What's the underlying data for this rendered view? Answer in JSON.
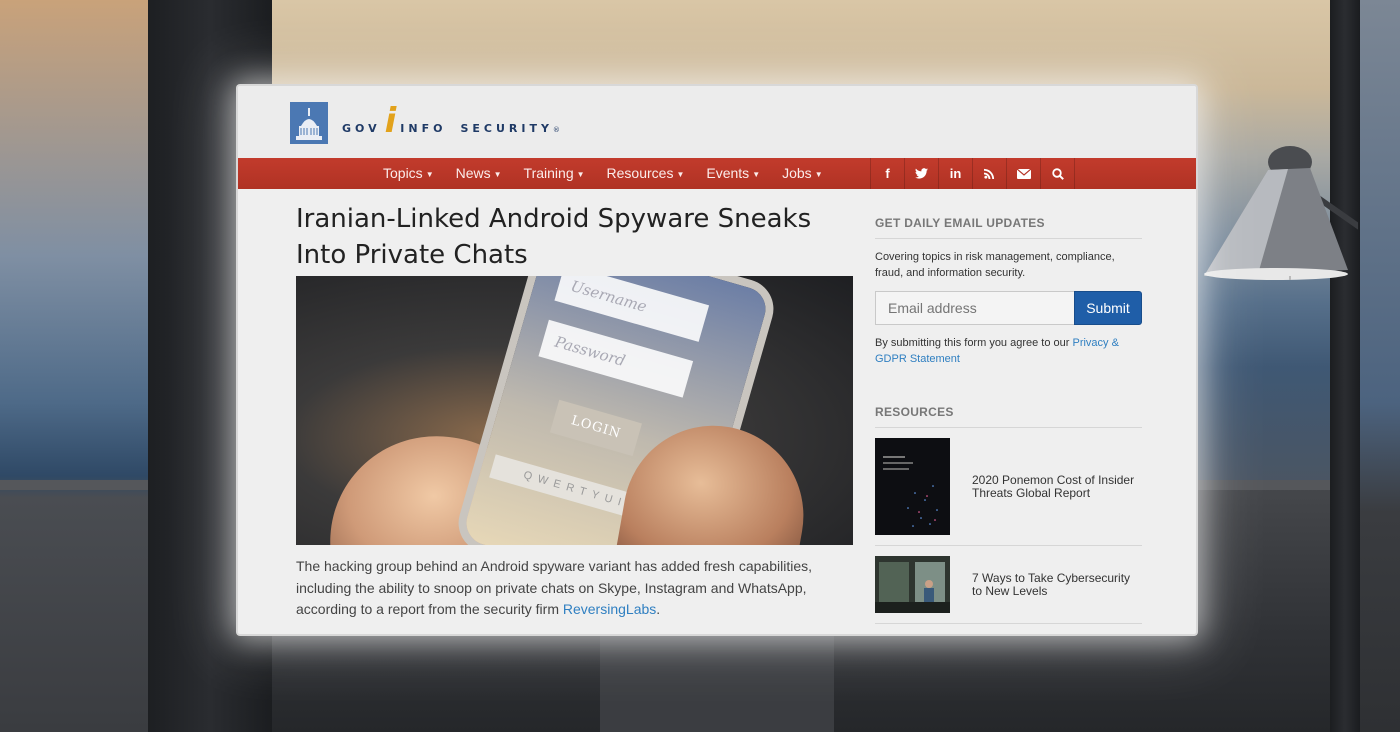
{
  "site": {
    "logo_gov": "GOV",
    "logo_i": "i",
    "logo_info": "INFO",
    "logo_security": "SECURITY",
    "logo_reg": "®"
  },
  "nav": {
    "items": [
      {
        "label": "Topics"
      },
      {
        "label": "News"
      },
      {
        "label": "Training"
      },
      {
        "label": "Resources"
      },
      {
        "label": "Events"
      },
      {
        "label": "Jobs"
      }
    ],
    "icons": [
      {
        "glyph": "f",
        "name": "facebook-icon"
      },
      {
        "glyph": "🐦",
        "name": "twitter-icon"
      },
      {
        "glyph": "in",
        "name": "linkedin-icon"
      },
      {
        "glyph": "◗",
        "name": "rss-icon"
      },
      {
        "glyph": "✉",
        "name": "envelope-icon"
      },
      {
        "glyph": "⌕",
        "name": "search-icon"
      }
    ],
    "accent_color": "#c0392b"
  },
  "article": {
    "title": "Iranian-Linked Android Spyware Sneaks Into Private Chats",
    "hero": {
      "username": "Username",
      "password": "Password",
      "login": "LOGIN",
      "keys": "QWERTYUIOP"
    },
    "lead_text": "The hacking group behind an Android spyware variant has added fresh capabilities, including the ability to snoop on private chats on Skype, Instagram and WhatsApp, according to a report from the security firm ",
    "lead_link": "ReversingLabs",
    "lead_end": "."
  },
  "sidebar": {
    "email_heading": "GET DAILY EMAIL UPDATES",
    "email_blurb": "Covering topics in risk management, compliance, fraud, and information security.",
    "email_placeholder": "Email address",
    "submit_label": "Submit",
    "consent_text": "By submitting this form you agree to our ",
    "consent_link": "Privacy & GDPR Statement",
    "resources_heading": "RESOURCES",
    "resources": [
      {
        "title": "2020 Ponemon Cost of Insider Threats Global Report"
      },
      {
        "title": "7 Ways to Take Cybersecurity to New Levels"
      }
    ]
  }
}
